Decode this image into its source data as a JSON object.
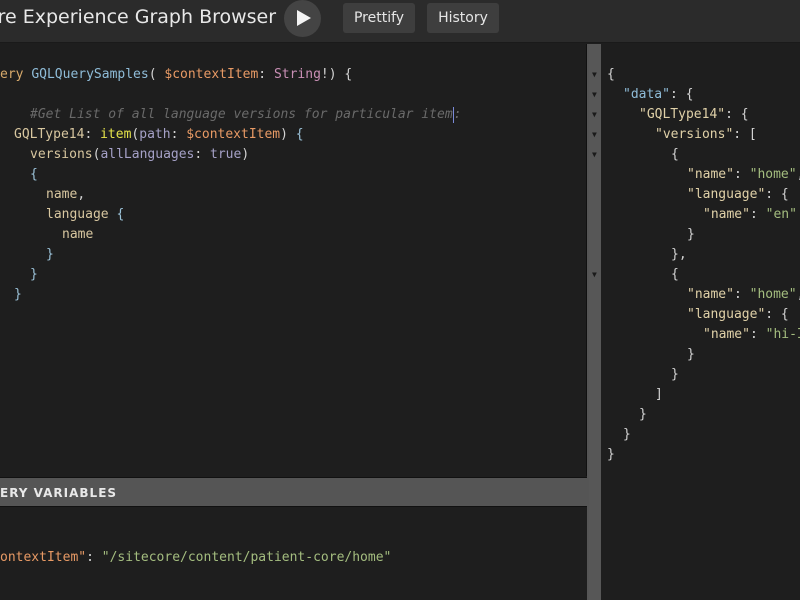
{
  "header": {
    "title": "ore Experience Graph Browser",
    "run_label": "Execute query",
    "prettify_label": "Prettify",
    "history_label": "History"
  },
  "query_editor": {
    "line1": {
      "kw": "ery",
      "name": "GQLQuerySamples",
      "open": "( ",
      "var": "$contextItem",
      "colon": ": ",
      "type": "String",
      "close": "!) {"
    },
    "comment": "#Get List of all language versions for particular item",
    "comment_tail": ":",
    "alias": "GQLType14",
    "fn": "item",
    "arg": "path",
    "arg_var": "$contextItem",
    "versions": "versions",
    "versions_arg": "allLanguages",
    "versions_val": "true",
    "name_field": "name",
    "language_field": "language",
    "inner_name_field": "name"
  },
  "variables": {
    "header_label": "ERY VARIABLES",
    "key": "ontextItem",
    "value": "\"/sitecore/content/patient-core/home\""
  },
  "result": {
    "data_key": "\"data\"",
    "alias_key": "\"GQLType14\"",
    "versions_key": "\"versions\"",
    "items": [
      {
        "name_key": "\"name\"",
        "name_val": "\"home\"",
        "language_key": "\"language\"",
        "lang_name_key": "\"name\"",
        "lang_name_val": "\"en\""
      },
      {
        "name_key": "\"name\"",
        "name_val": "\"home\"",
        "language_key": "\"language\"",
        "lang_name_key": "\"name\"",
        "lang_name_val": "\"hi-I"
      }
    ]
  },
  "colors": {
    "background": "#1e1e1e",
    "toolbar": "#2b2b2b",
    "divider": "#555555",
    "keyword": "#d7a96b",
    "definition": "#8fbcd8",
    "variable": "#e89a65",
    "string": "#a4bd7f"
  }
}
